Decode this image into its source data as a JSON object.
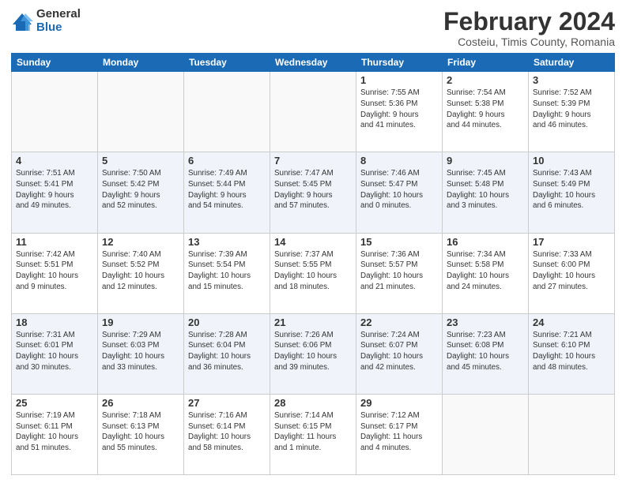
{
  "logo": {
    "general": "General",
    "blue": "Blue"
  },
  "header": {
    "month": "February 2024",
    "location": "Costeiu, Timis County, Romania"
  },
  "weekdays": [
    "Sunday",
    "Monday",
    "Tuesday",
    "Wednesday",
    "Thursday",
    "Friday",
    "Saturday"
  ],
  "weeks": [
    [
      {
        "day": "",
        "info": ""
      },
      {
        "day": "",
        "info": ""
      },
      {
        "day": "",
        "info": ""
      },
      {
        "day": "",
        "info": ""
      },
      {
        "day": "1",
        "info": "Sunrise: 7:55 AM\nSunset: 5:36 PM\nDaylight: 9 hours\nand 41 minutes."
      },
      {
        "day": "2",
        "info": "Sunrise: 7:54 AM\nSunset: 5:38 PM\nDaylight: 9 hours\nand 44 minutes."
      },
      {
        "day": "3",
        "info": "Sunrise: 7:52 AM\nSunset: 5:39 PM\nDaylight: 9 hours\nand 46 minutes."
      }
    ],
    [
      {
        "day": "4",
        "info": "Sunrise: 7:51 AM\nSunset: 5:41 PM\nDaylight: 9 hours\nand 49 minutes."
      },
      {
        "day": "5",
        "info": "Sunrise: 7:50 AM\nSunset: 5:42 PM\nDaylight: 9 hours\nand 52 minutes."
      },
      {
        "day": "6",
        "info": "Sunrise: 7:49 AM\nSunset: 5:44 PM\nDaylight: 9 hours\nand 54 minutes."
      },
      {
        "day": "7",
        "info": "Sunrise: 7:47 AM\nSunset: 5:45 PM\nDaylight: 9 hours\nand 57 minutes."
      },
      {
        "day": "8",
        "info": "Sunrise: 7:46 AM\nSunset: 5:47 PM\nDaylight: 10 hours\nand 0 minutes."
      },
      {
        "day": "9",
        "info": "Sunrise: 7:45 AM\nSunset: 5:48 PM\nDaylight: 10 hours\nand 3 minutes."
      },
      {
        "day": "10",
        "info": "Sunrise: 7:43 AM\nSunset: 5:49 PM\nDaylight: 10 hours\nand 6 minutes."
      }
    ],
    [
      {
        "day": "11",
        "info": "Sunrise: 7:42 AM\nSunset: 5:51 PM\nDaylight: 10 hours\nand 9 minutes."
      },
      {
        "day": "12",
        "info": "Sunrise: 7:40 AM\nSunset: 5:52 PM\nDaylight: 10 hours\nand 12 minutes."
      },
      {
        "day": "13",
        "info": "Sunrise: 7:39 AM\nSunset: 5:54 PM\nDaylight: 10 hours\nand 15 minutes."
      },
      {
        "day": "14",
        "info": "Sunrise: 7:37 AM\nSunset: 5:55 PM\nDaylight: 10 hours\nand 18 minutes."
      },
      {
        "day": "15",
        "info": "Sunrise: 7:36 AM\nSunset: 5:57 PM\nDaylight: 10 hours\nand 21 minutes."
      },
      {
        "day": "16",
        "info": "Sunrise: 7:34 AM\nSunset: 5:58 PM\nDaylight: 10 hours\nand 24 minutes."
      },
      {
        "day": "17",
        "info": "Sunrise: 7:33 AM\nSunset: 6:00 PM\nDaylight: 10 hours\nand 27 minutes."
      }
    ],
    [
      {
        "day": "18",
        "info": "Sunrise: 7:31 AM\nSunset: 6:01 PM\nDaylight: 10 hours\nand 30 minutes."
      },
      {
        "day": "19",
        "info": "Sunrise: 7:29 AM\nSunset: 6:03 PM\nDaylight: 10 hours\nand 33 minutes."
      },
      {
        "day": "20",
        "info": "Sunrise: 7:28 AM\nSunset: 6:04 PM\nDaylight: 10 hours\nand 36 minutes."
      },
      {
        "day": "21",
        "info": "Sunrise: 7:26 AM\nSunset: 6:06 PM\nDaylight: 10 hours\nand 39 minutes."
      },
      {
        "day": "22",
        "info": "Sunrise: 7:24 AM\nSunset: 6:07 PM\nDaylight: 10 hours\nand 42 minutes."
      },
      {
        "day": "23",
        "info": "Sunrise: 7:23 AM\nSunset: 6:08 PM\nDaylight: 10 hours\nand 45 minutes."
      },
      {
        "day": "24",
        "info": "Sunrise: 7:21 AM\nSunset: 6:10 PM\nDaylight: 10 hours\nand 48 minutes."
      }
    ],
    [
      {
        "day": "25",
        "info": "Sunrise: 7:19 AM\nSunset: 6:11 PM\nDaylight: 10 hours\nand 51 minutes."
      },
      {
        "day": "26",
        "info": "Sunrise: 7:18 AM\nSunset: 6:13 PM\nDaylight: 10 hours\nand 55 minutes."
      },
      {
        "day": "27",
        "info": "Sunrise: 7:16 AM\nSunset: 6:14 PM\nDaylight: 10 hours\nand 58 minutes."
      },
      {
        "day": "28",
        "info": "Sunrise: 7:14 AM\nSunset: 6:15 PM\nDaylight: 11 hours\nand 1 minute."
      },
      {
        "day": "29",
        "info": "Sunrise: 7:12 AM\nSunset: 6:17 PM\nDaylight: 11 hours\nand 4 minutes."
      },
      {
        "day": "",
        "info": ""
      },
      {
        "day": "",
        "info": ""
      }
    ]
  ]
}
